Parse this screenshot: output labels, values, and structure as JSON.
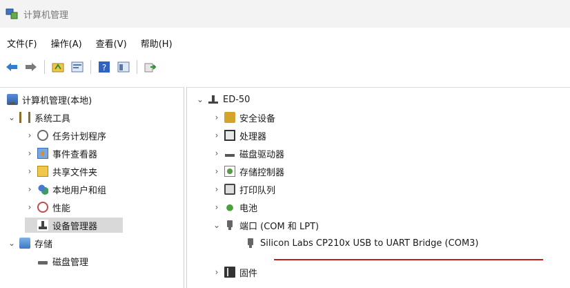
{
  "window": {
    "title": "计算机管理"
  },
  "menu": [
    "文件(F)",
    "操作(A)",
    "查看(V)",
    "帮助(H)"
  ],
  "toolbar": {
    "buttons": [
      "back-icon",
      "forward-icon",
      "up-icon",
      "properties-icon",
      "help-icon",
      "view-icon",
      "export-icon"
    ]
  },
  "tree": {
    "root": "计算机管理(本地)",
    "system_tools": "系统工具",
    "task_scheduler": "任务计划程序",
    "event_viewer": "事件查看器",
    "shared_folders": "共享文件夹",
    "local_users": "本地用户和组",
    "performance": "性能",
    "device_manager": "设备管理器",
    "storage": "存储",
    "disk_management": "磁盘管理"
  },
  "devices": {
    "computer": "ED-50",
    "items": [
      "安全设备",
      "处理器",
      "磁盘驱动器",
      "存储控制器",
      "打印队列",
      "电池",
      "端口 (COM 和 LPT)",
      "Silicon Labs CP210x USB to UART Bridge (COM3)",
      "固件"
    ]
  },
  "colors": {
    "selection": "#d9d9d9",
    "highlight_underline": "#c41a1a"
  }
}
